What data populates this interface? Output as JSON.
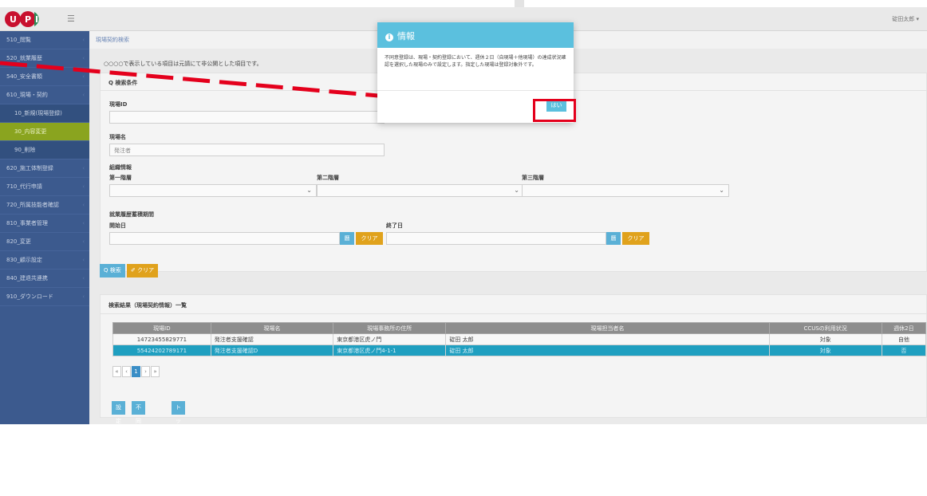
{
  "header": {
    "logo_text": "UPI",
    "user_name": "碇田太郎 ▾"
  },
  "sidebar": {
    "items": [
      {
        "label": "510_閲覧",
        "kind": "top"
      },
      {
        "label": "520_就業履歴",
        "kind": "top"
      },
      {
        "label": "540_安全書類",
        "kind": "top"
      },
      {
        "label": "610_現場・契約",
        "kind": "top"
      },
      {
        "label": "10_新規(現場登録)",
        "kind": "sub"
      },
      {
        "label": "30_内容変更",
        "kind": "active"
      },
      {
        "label": "90_削除",
        "kind": "sub"
      },
      {
        "label": "620_施工体制登録",
        "kind": "top"
      },
      {
        "label": "710_代行申請",
        "kind": "top"
      },
      {
        "label": "720_所属技能者確認",
        "kind": "top"
      },
      {
        "label": "810_事業者管理",
        "kind": "top"
      },
      {
        "label": "820_変更",
        "kind": "top"
      },
      {
        "label": "830_顧示設定",
        "kind": "top"
      },
      {
        "label": "840_建退共連携",
        "kind": "top"
      },
      {
        "label": "910_ダウンロード",
        "kind": "top"
      }
    ]
  },
  "main": {
    "breadcrumb": "現場契約検索",
    "notice": "○○○○で表示している項目は元請にて非公開とした項目です。",
    "search": {
      "title": "Q 検索条件",
      "site_id_label": "現場ID",
      "site_id_value": "",
      "site_name_label": "現場名",
      "site_name_value": "発注者",
      "org_label": "組織情報",
      "level1_label": "第一階層",
      "level2_label": "第二階層",
      "level3_label": "第三階層",
      "period_label": "就業履歴蓄積期間",
      "start_label": "開始日",
      "end_label": "終了日",
      "cal_label": "曆",
      "clear_label": "クリア",
      "search_btn": "Q 検索",
      "clear_btn": "✐ クリア"
    },
    "results": {
      "title": "検索結果（現場契約情報）一覧",
      "columns": [
        "現場ID",
        "現場名",
        "現場事務所の住所",
        "現場担当者名",
        "CCUSの利用状況",
        "週休2日"
      ],
      "rows": [
        [
          "14723455829771",
          "発注者支援確認",
          "東京都港区虎ノ門",
          "碇田 太郎",
          "対象",
          "自他"
        ],
        [
          "55424202789171",
          "発注者支援確認D",
          "東京都港区虎ノ門4-1-1",
          "碇田 太郎",
          "対象",
          "否"
        ]
      ],
      "pager": [
        "«",
        "‹",
        "1",
        "›",
        "»"
      ]
    },
    "bottom_buttons": [
      "設定",
      "不同意登録",
      "トップページへ"
    ]
  },
  "dialog": {
    "title": "情報",
    "body": "不同意登録は、現場・契約登録において、週休２日（自現場＋他現場）の達成状況確認を選択した現場のみで設定します。指定した現場は登録対象外です。",
    "yes_label": "はい"
  },
  "colors": {
    "sidebar": "#3c5a8e",
    "active": "#8aa41f",
    "accent": "#5bc0de",
    "highlight": "#e4001c"
  }
}
